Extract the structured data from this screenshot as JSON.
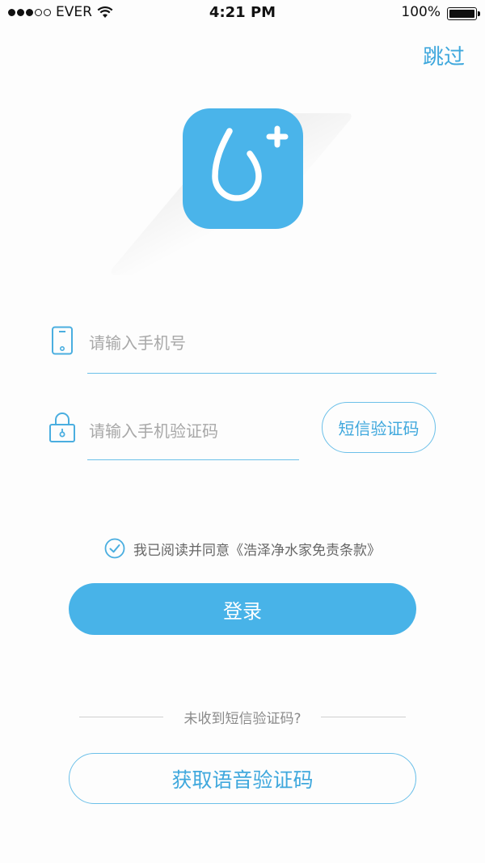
{
  "status_bar": {
    "carrier": "EVER",
    "time": "4:21 PM",
    "battery": "100%",
    "signal_dots_filled": 3,
    "signal_dots_total": 5
  },
  "header": {
    "skip_label": "跳过"
  },
  "logo": {
    "icon": "water-drop-plus-icon",
    "color": "#4ab4ea"
  },
  "login_form": {
    "phone": {
      "icon": "phone-icon",
      "placeholder": "请输入手机号",
      "value": ""
    },
    "code": {
      "icon": "lock-icon",
      "placeholder": "请输入手机验证码",
      "value": ""
    },
    "sms_code_button": "短信验证码"
  },
  "agreement": {
    "checked": true,
    "text": "我已阅读并同意《浩泽净水家免责条款》"
  },
  "login_button": "登录",
  "no_code": {
    "text": "未收到短信验证码?"
  },
  "voice_code_button": "获取语音验证码",
  "colors": {
    "accent": "#48b3e8",
    "line": "#6cc0e9",
    "background": "#fdfdfd"
  }
}
